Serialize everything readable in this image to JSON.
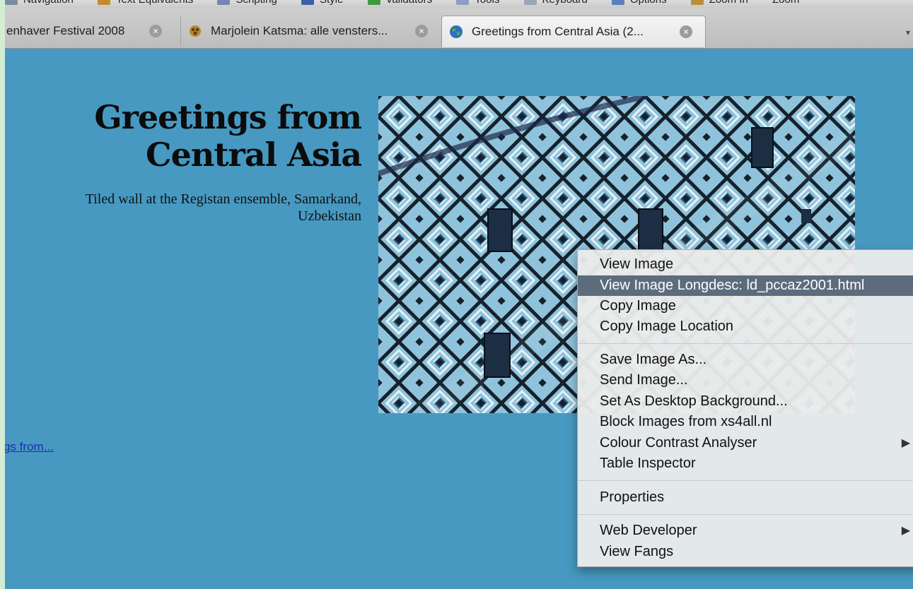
{
  "toolbar": {
    "items": [
      "Navigation",
      "Text Equivalents",
      "Scripting",
      "Style",
      "Validators",
      "Tools",
      "Keyboard",
      "Options",
      "Zoom In",
      "Zoom"
    ]
  },
  "tabs": [
    {
      "title": "enhaver Festival 2008",
      "active": false
    },
    {
      "title": "Marjolein Katsma: alle vensters...",
      "active": false
    },
    {
      "title": "Greetings from Central Asia (2...",
      "active": true
    }
  ],
  "tab_close_glyph": "×",
  "tab_list_glyph": "▾",
  "page": {
    "heading_line1": "Greetings from",
    "heading_line2": "Central Asia",
    "caption_line1": "Tiled wall at the Registan ensemble, Samarkand,",
    "caption_line2": "Uzbekistan",
    "link_text": "tings from..."
  },
  "context_menu": {
    "items": [
      {
        "label": "View Image"
      },
      {
        "label": "View Image Longdesc: ld_pccaz2001.html",
        "highlighted": true
      },
      {
        "label": "Copy Image"
      },
      {
        "label": "Copy Image Location"
      },
      {
        "label": "Save Image As..."
      },
      {
        "label": "Send Image..."
      },
      {
        "label": "Set As Desktop Background..."
      },
      {
        "label": "Block Images from xs4all.nl"
      },
      {
        "label": "Colour Contrast Analyser",
        "submenu": true
      },
      {
        "label": "Table Inspector"
      },
      {
        "label": "Properties"
      },
      {
        "label": "Web Developer",
        "submenu": true
      },
      {
        "label": "View Fangs"
      }
    ],
    "submenu_glyph": "▶"
  },
  "colors": {
    "page_bg": "#4799c1",
    "menu_highlight": "#5d6c7c",
    "tile_dark": "#16212c",
    "tile_light": "#9fd0e6"
  }
}
